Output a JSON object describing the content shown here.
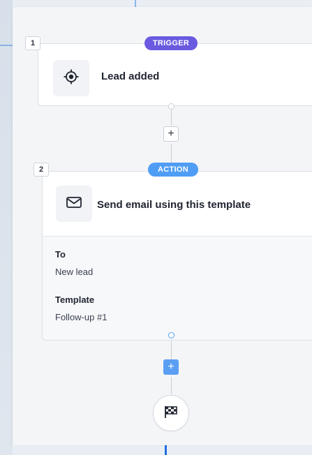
{
  "steps": [
    {
      "number": "1",
      "type": "TRIGGER",
      "title": "Lead added",
      "icon": "target-icon",
      "accent": "#6a5ae0"
    },
    {
      "number": "2",
      "type": "ACTION",
      "title": "Send email using this template",
      "icon": "envelope-icon",
      "accent": "#4f9df5",
      "details": [
        {
          "label": "To",
          "value": "New lead"
        },
        {
          "label": "Template",
          "value": "Follow-up #1"
        }
      ]
    }
  ],
  "add_step_label": "+",
  "finish_icon": "checkered-flag-icon",
  "colors": {
    "trigger": "#6a5ae0",
    "action": "#4f9df5",
    "add_active": "#5b9ff3",
    "connector": "#c9ced6"
  }
}
